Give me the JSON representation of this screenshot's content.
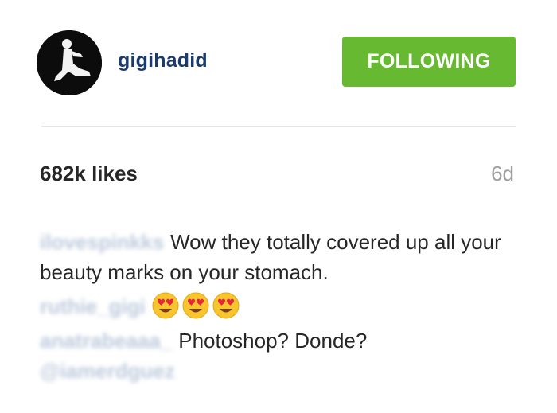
{
  "header": {
    "username": "gigihadid",
    "follow_label": "FOLLOWING"
  },
  "stats": {
    "likes": "682k likes",
    "age": "6d"
  },
  "comments": [
    {
      "author": "ilovespinkks",
      "text": "Wow they totally covered up all your beauty marks on your stomach."
    },
    {
      "author": "ruthie_gigi",
      "emoji": [
        "heart-eyes",
        "heart-eyes",
        "heart-eyes"
      ]
    },
    {
      "author": "anatrabeaaa_",
      "text": "Photoshop? Donde?",
      "mention": "@iamerdguez"
    }
  ],
  "colors": {
    "following_green": "#67b931",
    "username_navy": "#1a3b6e",
    "timestamp_gray": "#a0a0a0"
  }
}
